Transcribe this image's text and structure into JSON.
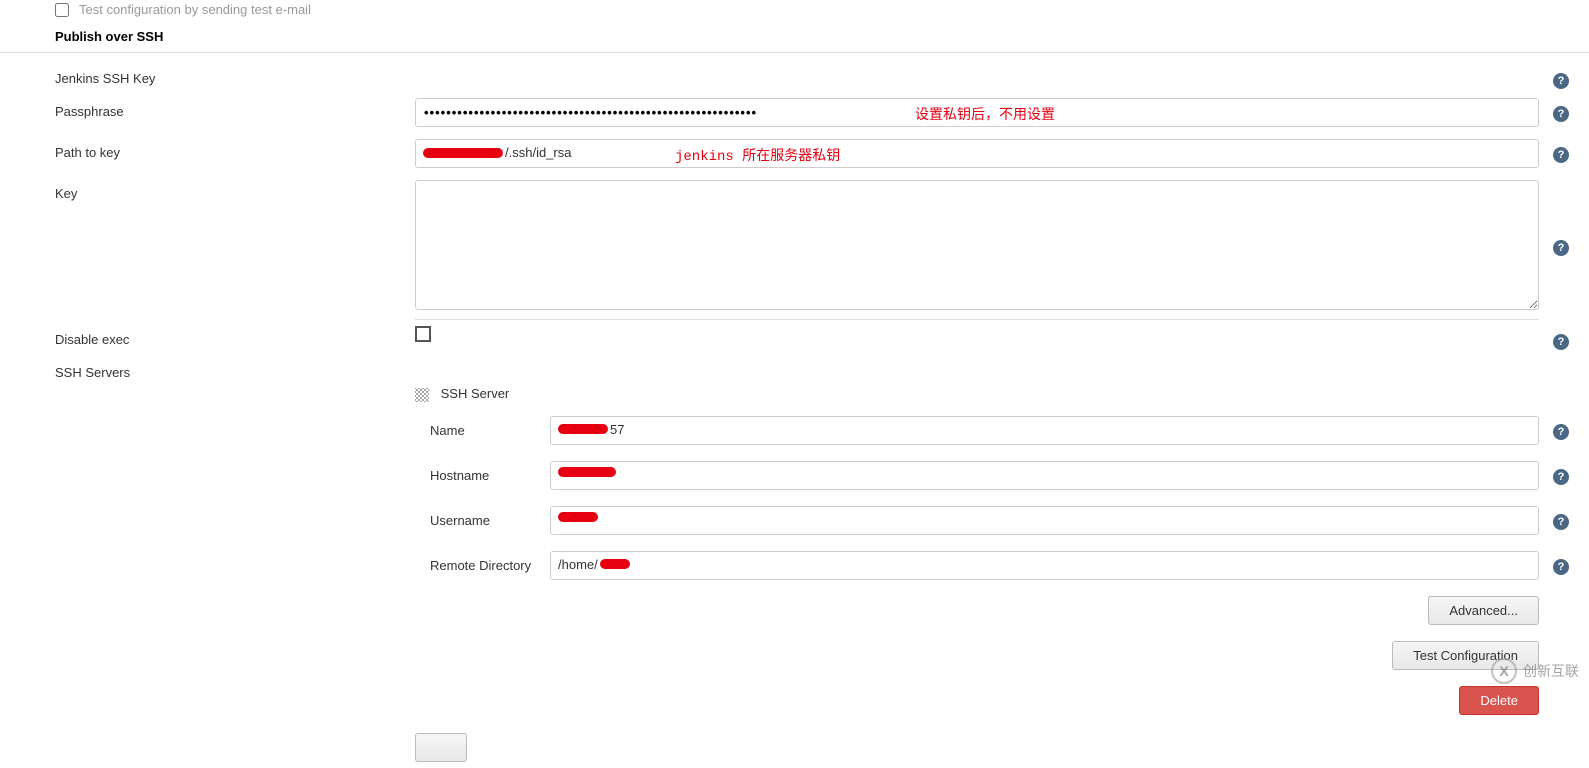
{
  "topCheckbox": {
    "label": "Test configuration by sending test e-mail"
  },
  "sectionTitle": "Publish over SSH",
  "labels": {
    "jenkinsSshKey": "Jenkins SSH Key",
    "passphrase": "Passphrase",
    "pathToKey": "Path to key",
    "key": "Key",
    "disableExec": "Disable exec",
    "sshServers": "SSH Servers"
  },
  "passphrase": {
    "value": "••••••••••••••••••••••••••••••••••••••••••••••••••••••••••••"
  },
  "pathToKey": {
    "suffix": "/.ssh/id_rsa"
  },
  "annotations": {
    "passphrase": "设置私钥后，不用设置",
    "pathToKey": "jenkins 所在服务器私钥"
  },
  "sshServer": {
    "header": "SSH Server",
    "nameLabel": "Name",
    "nameSuffix": "57",
    "hostnameLabel": "Hostname",
    "usernameLabel": "Username",
    "remoteDirLabel": "Remote Directory",
    "remoteDirValue": "/home/"
  },
  "buttons": {
    "advanced": "Advanced...",
    "testConfig": "Test Configuration",
    "delete": "Delete"
  },
  "watermark": "创新互联",
  "helpGlyph": "?"
}
